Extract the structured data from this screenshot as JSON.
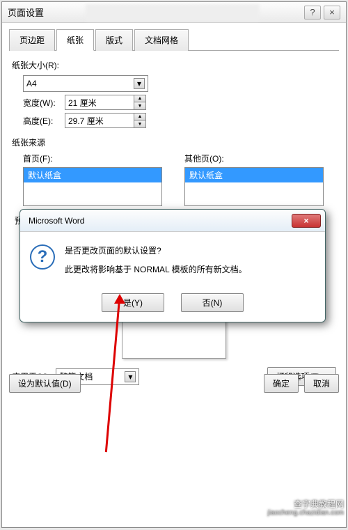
{
  "window": {
    "title": "页面设置",
    "help": "?",
    "close": "×"
  },
  "tabs": {
    "margin": "页边距",
    "paper": "纸张",
    "layout": "版式",
    "grid": "文档网格"
  },
  "paper_size": {
    "label": "纸张大小(R):",
    "value": "A4",
    "width_label": "宽度(W):",
    "width_value": "21 厘米",
    "height_label": "高度(E):",
    "height_value": "29.7 厘米"
  },
  "paper_source": {
    "legend": "纸张来源",
    "first_label": "首页(F):",
    "other_label": "其他页(O):",
    "option": "默认纸盒"
  },
  "preview": {
    "label": "预览"
  },
  "apply": {
    "label": "应用于(Y):",
    "value": "整篇文档",
    "print_options": "打印选项(T)..."
  },
  "footer": {
    "default": "设为默认值(D)",
    "ok": "确定",
    "cancel": "取消"
  },
  "popup": {
    "title": "Microsoft Word",
    "close": "×",
    "msg1": "是否更改页面的默认设置?",
    "msg2": "此更改将影响基于 NORMAL 模板的所有新文档。",
    "yes": "是(Y)",
    "no": "否(N)"
  },
  "watermark": {
    "line1": "查字典教程网",
    "line2": "jiaocheng.chazidian.com"
  }
}
